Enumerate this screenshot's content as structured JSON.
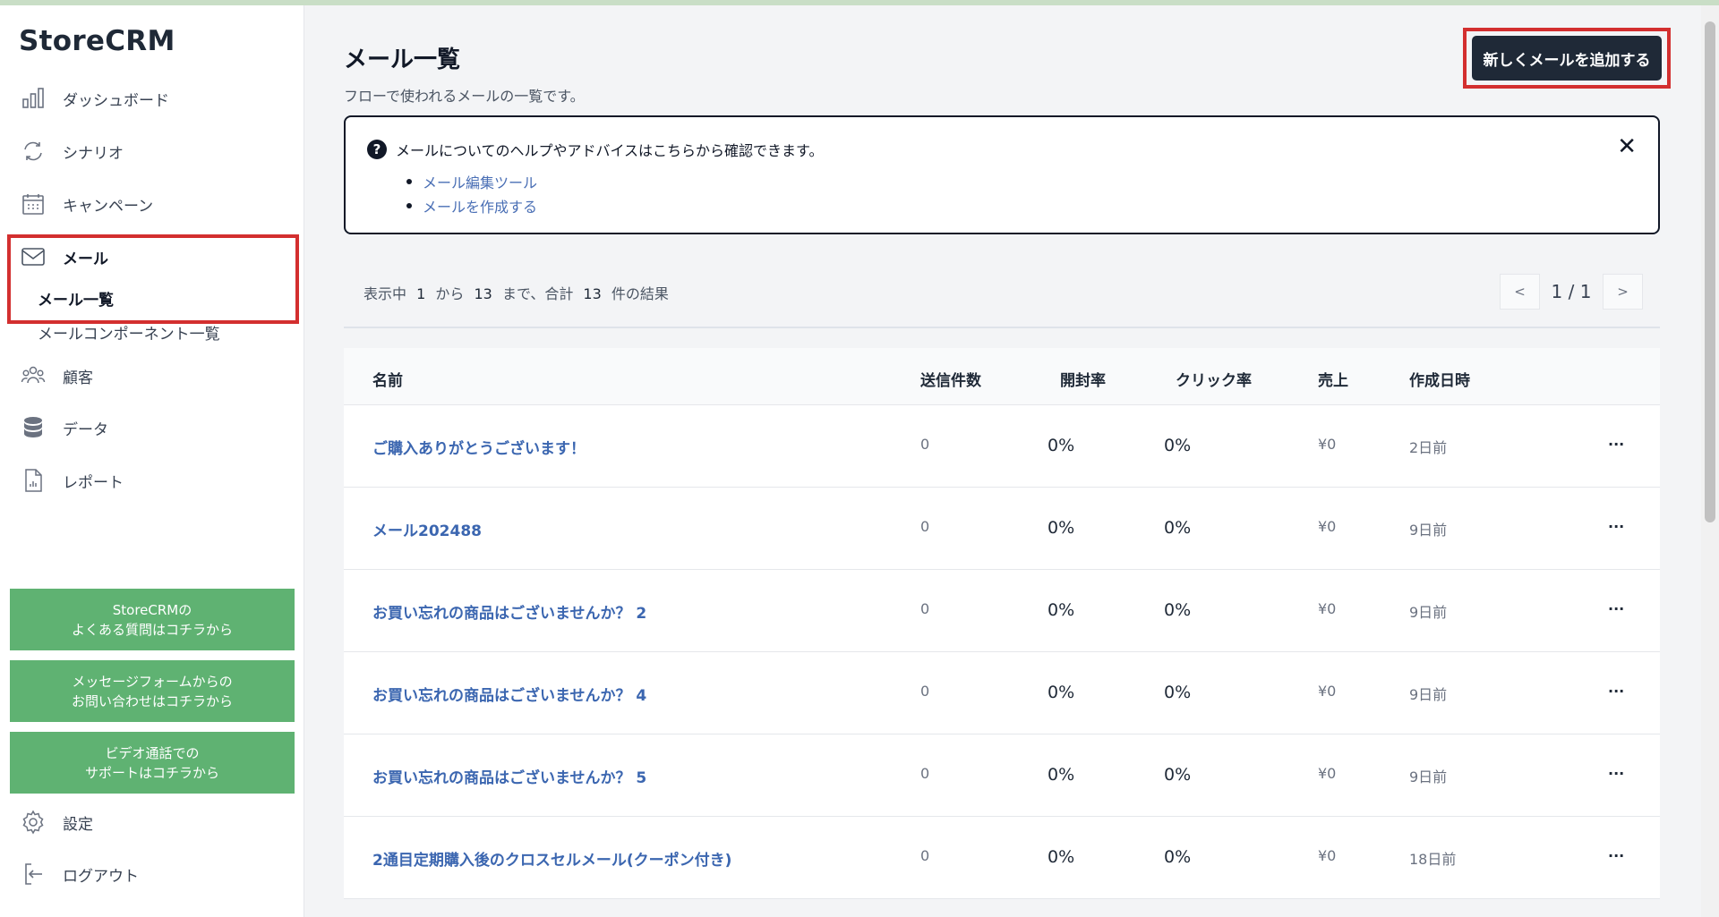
{
  "app": {
    "logo": "StoreCRM"
  },
  "sidebar": {
    "items": [
      {
        "label": "ダッシュボード",
        "icon": "bar-chart-icon"
      },
      {
        "label": "シナリオ",
        "icon": "refresh-icon"
      },
      {
        "label": "キャンペーン",
        "icon": "calendar-icon"
      },
      {
        "label": "メール",
        "icon": "mail-icon"
      },
      {
        "label": "顧客",
        "icon": "users-icon"
      },
      {
        "label": "データ",
        "icon": "database-icon"
      },
      {
        "label": "レポート",
        "icon": "report-icon"
      }
    ],
    "sub_items": [
      {
        "label": "メール一覧",
        "active": true
      },
      {
        "label": "メールコンポーネント一覧",
        "active": false
      }
    ],
    "support_buttons": [
      {
        "line1": "StoreCRMの",
        "line2": "よくある質問はコチラから"
      },
      {
        "line1": "メッセージフォームからの",
        "line2": "お問い合わせはコチラから"
      },
      {
        "line1": "ビデオ通話での",
        "line2": "サポートはコチラから"
      }
    ],
    "bottom_items": [
      {
        "label": "設定",
        "icon": "gear-icon"
      },
      {
        "label": "ログアウト",
        "icon": "logout-icon"
      }
    ]
  },
  "header": {
    "title": "メール一覧",
    "subtitle": "フローで使われるメールの一覧です。",
    "add_button": "新しくメールを追加する"
  },
  "help": {
    "title": "メールについてのヘルプやアドバイスはこちらから確認できます。",
    "close": "✕",
    "links": [
      "メール編集ツール",
      "メールを作成する"
    ]
  },
  "results": {
    "prefix": "表示中",
    "from": "1",
    "from_suffix": "から",
    "to": "13",
    "to_suffix": "まで、合計",
    "total": "13",
    "total_suffix": "件の結果"
  },
  "pager": {
    "prev": "<",
    "text": "1 / 1",
    "next": ">"
  },
  "table": {
    "columns": [
      "名前",
      "送信件数",
      "開封率",
      "クリック率",
      "売上",
      "作成日時"
    ],
    "rows": [
      {
        "name": "ご購入ありがとうございます！",
        "sent": "0",
        "open": "0%",
        "click": "0%",
        "sales": "¥0",
        "created": "2日前",
        "more": "..."
      },
      {
        "name": "メール202488",
        "sent": "0",
        "open": "0%",
        "click": "0%",
        "sales": "¥0",
        "created": "9日前",
        "more": "..."
      },
      {
        "name": "お買い忘れの商品はございませんか？ 2",
        "sent": "0",
        "open": "0%",
        "click": "0%",
        "sales": "¥0",
        "created": "9日前",
        "more": "..."
      },
      {
        "name": "お買い忘れの商品はございませんか？ 4",
        "sent": "0",
        "open": "0%",
        "click": "0%",
        "sales": "¥0",
        "created": "9日前",
        "more": "..."
      },
      {
        "name": "お買い忘れの商品はございませんか？ 5",
        "sent": "0",
        "open": "0%",
        "click": "0%",
        "sales": "¥0",
        "created": "9日前",
        "more": "..."
      },
      {
        "name": "2通目定期購入後のクロスセルメール(クーポン付き)",
        "sent": "0",
        "open": "0%",
        "click": "0%",
        "sales": "¥0",
        "created": "18日前",
        "more": "..."
      }
    ]
  },
  "colors": {
    "highlight": "#d32f2f",
    "support_green": "#5fb272",
    "link_blue": "#3b66b0",
    "dark_button": "#1f2937"
  }
}
